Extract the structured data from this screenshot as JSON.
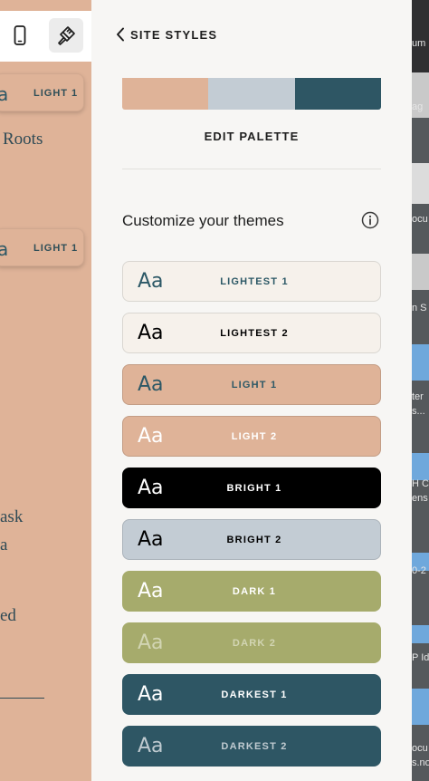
{
  "colors": {
    "panel_bg": "#f7f6f4",
    "preview_bg": "#dfb398",
    "text_dark": "#1d1d1d",
    "teal": "#2c5866"
  },
  "sidebar_preview": {
    "toolbar": {
      "mobile_icon": "mobile-phone-icon",
      "brush_icon": "paintbrush-icon"
    },
    "sections": [
      {
        "aa": "a",
        "label": "LIGHT 1"
      },
      {
        "aa": "a",
        "label": "LIGHT 1"
      }
    ],
    "text_fragments": [
      "Roots",
      "ask",
      "a",
      "ed"
    ]
  },
  "header": {
    "back_icon": "chevron-left-icon",
    "title": "SITE STYLES"
  },
  "palette": {
    "swatches": [
      "#dfb398",
      "#c3ccd4",
      "#2e5664"
    ],
    "edit_label": "EDIT PALETTE"
  },
  "themes_section": {
    "heading": "Customize your themes",
    "info_icon": "info-icon",
    "themes": [
      {
        "aa": "Aa",
        "label": "LIGHTEST 1",
        "bg": "#f6f1eb",
        "aa_color": "#2c5866",
        "label_color": "#2c5866"
      },
      {
        "aa": "Aa",
        "label": "LIGHTEST 2",
        "bg": "#f6f1eb",
        "aa_color": "#000000",
        "label_color": "#000000"
      },
      {
        "aa": "Aa",
        "label": "LIGHT 1",
        "bg": "#dfb398",
        "aa_color": "#2c5866",
        "label_color": "#2c5866"
      },
      {
        "aa": "Aa",
        "label": "LIGHT 2",
        "bg": "#dfb398",
        "aa_color": "#ffffff",
        "label_color": "#ffffff"
      },
      {
        "aa": "Aa",
        "label": "BRIGHT 1",
        "bg": "#000000",
        "aa_color": "#ffffff",
        "label_color": "#ffffff"
      },
      {
        "aa": "Aa",
        "label": "BRIGHT 2",
        "bg": "#c3ccd4",
        "aa_color": "#000000",
        "label_color": "#000000"
      },
      {
        "aa": "Aa",
        "label": "DARK 1",
        "bg": "#a6ab6c",
        "aa_color": "#ffffff",
        "label_color": "#ffffff"
      },
      {
        "aa": "Aa",
        "label": "DARK 2",
        "bg": "#a6ab6c",
        "aa_color": "#d2d5b3",
        "label_color": "#d2d5b3"
      },
      {
        "aa": "Aa",
        "label": "DARKEST 1",
        "bg": "#2e5664",
        "aa_color": "#ffffff",
        "label_color": "#ffffff"
      },
      {
        "aa": "Aa",
        "label": "DARKEST 2",
        "bg": "#2e5664",
        "aa_color": "#bfcad0",
        "label_color": "#bfcad0"
      }
    ]
  },
  "background_strip": {
    "fragments": [
      "um",
      "ag",
      "ocu",
      "n S",
      "ter",
      "s...",
      "H C",
      "ens",
      "0-2",
      "P Id",
      "ocu",
      "s.no"
    ]
  }
}
